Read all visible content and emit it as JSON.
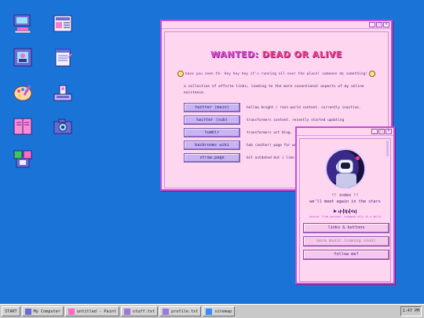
{
  "desktop_icons": [
    {
      "name": "computer-icon"
    },
    {
      "name": "newspaper-icon"
    },
    {
      "name": "picture-icon"
    },
    {
      "name": "notepad-icon"
    },
    {
      "name": "paint-palette-icon"
    },
    {
      "name": "scanner-icon"
    },
    {
      "name": "book-icon"
    },
    {
      "name": "camera-icon"
    },
    {
      "name": "setup-icon"
    }
  ],
  "main_window": {
    "title_part1": "WANTED:",
    "title_part2": "DEAD OR ALIVE",
    "greeting": "have you seen th- hey hey hey it's running all over the place! someone do something!",
    "description": "a collection of offsite links, leading to the more coventional aspects of my online existence.",
    "links": [
      {
        "label": "twitter (main)",
        "desc": "hollow knight / rain world content. currently inactive."
      },
      {
        "label": "twitter (sub)",
        "desc": "transformers content. recently started updating"
      },
      {
        "label": "tumblr",
        "desc": "transformers art blog."
      },
      {
        "label": "backrooms wiki",
        "desc": "hub (author) page for writing."
      },
      {
        "label": "straw.page",
        "desc": "bit outdated but i like the look of it"
      }
    ],
    "controls": {
      "minimize": "_",
      "maximize": "□",
      "close": "×"
    }
  },
  "profile_window": {
    "name": "!! index !!",
    "subtitle": "we'll meet again in the stars",
    "source": "source: from youtube. snapped only in a while",
    "buttons": [
      {
        "label": "links & buttons"
      },
      {
        "label": "more music (coming soon)"
      },
      {
        "label": "follow me?"
      }
    ],
    "controls": {
      "minimize": "_",
      "maximize": "□",
      "close": "×"
    }
  },
  "taskbar": {
    "start": "START",
    "items": [
      {
        "label": "My Computer",
        "icon": "computer-icon"
      },
      {
        "label": "untitled - Paint",
        "icon": "paint-icon"
      },
      {
        "label": "stuff.txt",
        "icon": "notepad-icon"
      },
      {
        "label": "profile.txt",
        "icon": "notepad-icon"
      },
      {
        "label": "sitemap",
        "icon": "window-icon"
      }
    ],
    "clock": "1:47 PM"
  },
  "colors": {
    "desktop": "#1a73d6",
    "window_bg": "#ffd6ef",
    "window_border": "#c14fd8",
    "title_pink": "#e04cc8",
    "title_red": "#ff3d7a",
    "link_button": "#c9b4f2",
    "taskbar": "#c9c9c9"
  }
}
